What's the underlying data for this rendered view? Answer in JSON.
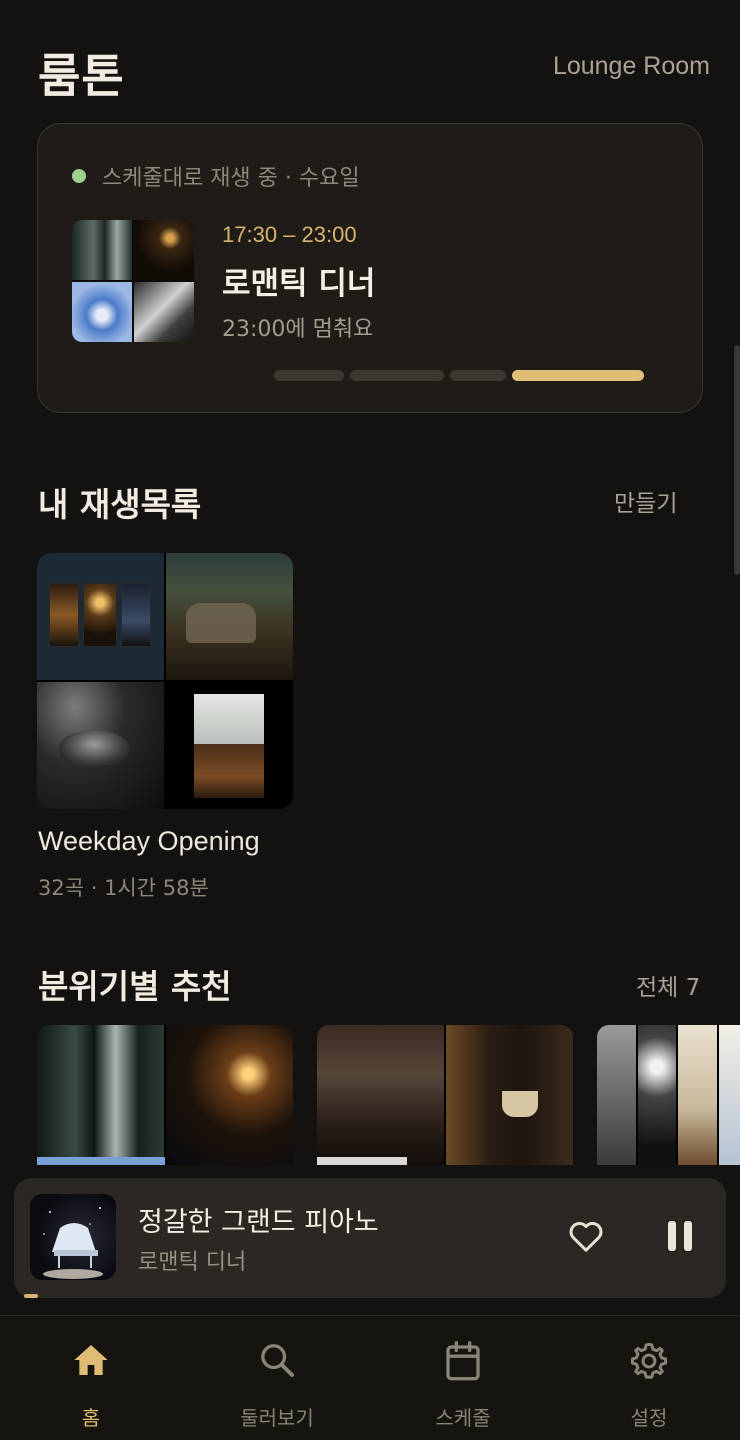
{
  "header": {
    "title": "룸톤",
    "room": "Lounge Room"
  },
  "now_playing_card": {
    "status": "스케줄대로 재생 중 · 수요일",
    "status_color": "#9ecf8e",
    "time_range": "17:30 – 23:00",
    "title": "로맨틱 디너",
    "stop_note": "23:00에 멈춰요",
    "schedule_segments_active_index": 3
  },
  "my_playlists": {
    "title": "내 재생목록",
    "action": "만들기",
    "items": [
      {
        "name": "Weekday Opening",
        "meta": "32곡 · 1시간 58분"
      }
    ]
  },
  "mood": {
    "title": "분위기별 추천",
    "action": "전체 7"
  },
  "mini_player": {
    "title": "정갈한 그랜드 피아노",
    "subtitle": "로맨틱 디너",
    "like_icon": "heart-icon",
    "pause_icon": "pause-icon"
  },
  "tabs": [
    {
      "label": "홈",
      "icon": "home-icon",
      "active": true
    },
    {
      "label": "둘러보기",
      "icon": "search-icon",
      "active": false
    },
    {
      "label": "스케줄",
      "icon": "calendar-icon",
      "active": false
    },
    {
      "label": "설정",
      "icon": "gear-icon",
      "active": false
    }
  ],
  "colors": {
    "accent": "#e0bb74",
    "background": "#141210",
    "card": "#1f1c18"
  }
}
